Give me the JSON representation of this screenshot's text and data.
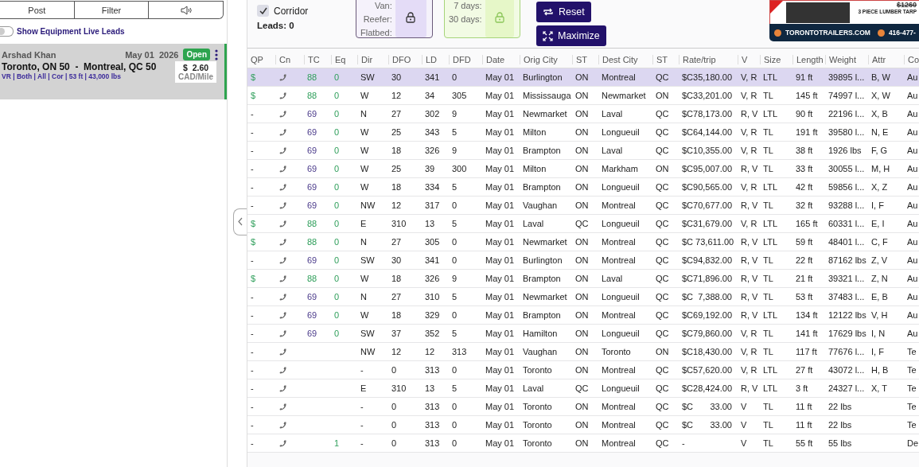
{
  "left_panel": {
    "tabs": [
      {
        "kind": "text",
        "label": "Post"
      },
      {
        "kind": "text",
        "label": "Filter"
      },
      {
        "kind": "sound"
      }
    ],
    "live_leads_toggle": {
      "label": "Show Equipment Live Leads",
      "on": false
    },
    "lead_card": {
      "name": "Arshad Khan",
      "date": "May 01  2026",
      "status": "Open",
      "route": "Toronto, ON 50  -  Montreal, QC 50",
      "details": "VR | Both | All | Cor | 53 ft | 43,000 lbs",
      "rate": "$  2.60",
      "rate_unit": "CAD/Mile"
    }
  },
  "toolbar": {
    "corridor": {
      "label": "Corridor",
      "checked": true
    },
    "leads": "Leads: 0",
    "equipment_box": {
      "labels": [
        "Van:",
        "Reefer:",
        "Flatbed:"
      ]
    },
    "period_box": {
      "labels": [
        "7 days:",
        "30 days:"
      ]
    },
    "buttons": [
      {
        "kind": "reset",
        "label": "Reset"
      },
      {
        "kind": "maximize",
        "label": "Maximize"
      }
    ]
  },
  "ad": {
    "old_price": "$1260",
    "product": "3 PIECE LUMBER TARP",
    "website": "TORONTOTRAILERS.COM",
    "phone": "416-477-"
  },
  "table": {
    "columns": [
      "QP",
      "Cn",
      "TC",
      "Eq",
      "Dir",
      "DFO",
      "LD",
      "DFD",
      "Date",
      "Orig City",
      "ST",
      "Dest City",
      "ST",
      "Rate/trip",
      "V",
      "Size",
      "Length",
      "Weight",
      "Attr",
      "Co"
    ],
    "rows": [
      {
        "selected": true,
        "kind": "quickpay",
        "qp": "$",
        "tc": "88",
        "eq": "0",
        "dir": "SW",
        "dfo": "30",
        "ld": "341",
        "dfd": "0",
        "date": "May 01",
        "orig": "Burlington",
        "ost": "ON",
        "dest": "Montreal",
        "dst": "QC",
        "rate": "$C35,180.00",
        "v": "V, R",
        "size": "LTL",
        "length": "91 ft",
        "weight": "39895 l...",
        "attr": "B, W",
        "col20": "Au"
      },
      {
        "selected": false,
        "kind": "quickpay",
        "qp": "$",
        "tc": "88",
        "eq": "0",
        "dir": "W",
        "dfo": "12",
        "ld": "34",
        "dfd": "305",
        "date": "May 01",
        "orig": "Mississauga",
        "ost": "ON",
        "dest": "Newmarket",
        "dst": "ON",
        "rate": "$C33,201.00",
        "v": "V, R",
        "size": "TL",
        "length": "145 ft",
        "weight": "74997 l...",
        "attr": "X, W",
        "col20": "Au"
      },
      {
        "selected": false,
        "kind": "standard",
        "qp": "-",
        "tc": "69",
        "eq": "0",
        "dir": "N",
        "dfo": "27",
        "ld": "302",
        "dfd": "9",
        "date": "May 01",
        "orig": "Newmarket",
        "ost": "ON",
        "dest": "Laval",
        "dst": "QC",
        "rate": "$C78,173.00",
        "v": "R, V",
        "size": "LTL",
        "length": "90 ft",
        "weight": "22196 l...",
        "attr": "X, B",
        "col20": "Au"
      },
      {
        "selected": false,
        "kind": "standard",
        "qp": "-",
        "tc": "69",
        "eq": "0",
        "dir": "W",
        "dfo": "25",
        "ld": "343",
        "dfd": "5",
        "date": "May 01",
        "orig": "Milton",
        "ost": "ON",
        "dest": "Longueuil",
        "dst": "QC",
        "rate": "$C64,144.00",
        "v": "V, R",
        "size": "TL",
        "length": "191 ft",
        "weight": "39580 l...",
        "attr": "N, E",
        "col20": "Au"
      },
      {
        "selected": false,
        "kind": "standard",
        "qp": "-",
        "tc": "69",
        "eq": "0",
        "dir": "W",
        "dfo": "18",
        "ld": "326",
        "dfd": "9",
        "date": "May 01",
        "orig": "Brampton",
        "ost": "ON",
        "dest": "Laval",
        "dst": "QC",
        "rate": "$C10,355.00",
        "v": "V, R",
        "size": "TL",
        "length": "38 ft",
        "weight": "1926 lbs",
        "attr": "F, G",
        "col20": "Au"
      },
      {
        "selected": false,
        "kind": "standard",
        "qp": "-",
        "tc": "69",
        "eq": "0",
        "dir": "W",
        "dfo": "25",
        "ld": "39",
        "dfd": "300",
        "date": "May 01",
        "orig": "Milton",
        "ost": "ON",
        "dest": "Markham",
        "dst": "ON",
        "rate": "$C95,007.00",
        "v": "R, V",
        "size": "TL",
        "length": "33 ft",
        "weight": "30055 l...",
        "attr": "M, H",
        "col20": "Au"
      },
      {
        "selected": false,
        "kind": "standard",
        "qp": "-",
        "tc": "69",
        "eq": "0",
        "dir": "W",
        "dfo": "18",
        "ld": "334",
        "dfd": "5",
        "date": "May 01",
        "orig": "Brampton",
        "ost": "ON",
        "dest": "Longueuil",
        "dst": "QC",
        "rate": "$C90,565.00",
        "v": "V, R",
        "size": "LTL",
        "length": "42 ft",
        "weight": "59856 l...",
        "attr": "X, Z",
        "col20": "Au"
      },
      {
        "selected": false,
        "kind": "standard",
        "qp": "-",
        "tc": "69",
        "eq": "0",
        "dir": "NW",
        "dfo": "12",
        "ld": "317",
        "dfd": "0",
        "date": "May 01",
        "orig": "Vaughan",
        "ost": "ON",
        "dest": "Montreal",
        "dst": "QC",
        "rate": "$C70,677.00",
        "v": "R, V",
        "size": "TL",
        "length": "32 ft",
        "weight": "93288 l...",
        "attr": "I, F",
        "col20": "Au"
      },
      {
        "selected": false,
        "kind": "quickpay",
        "qp": "$",
        "tc": "88",
        "eq": "0",
        "dir": "E",
        "dfo": "310",
        "ld": "13",
        "dfd": "5",
        "date": "May 01",
        "orig": "Laval",
        "ost": "QC",
        "dest": "Longueuil",
        "dst": "QC",
        "rate": "$C31,679.00",
        "v": "V, R",
        "size": "LTL",
        "length": "165 ft",
        "weight": "60331 l...",
        "attr": "E, I",
        "col20": "Au"
      },
      {
        "selected": false,
        "kind": "quickpay",
        "qp": "$",
        "tc": "88",
        "eq": "0",
        "dir": "N",
        "dfo": "27",
        "ld": "305",
        "dfd": "0",
        "date": "May 01",
        "orig": "Newmarket",
        "ost": "ON",
        "dest": "Montreal",
        "dst": "QC",
        "rate": "$C 73,611.00",
        "v": "R, V",
        "size": "LTL",
        "length": "59 ft",
        "weight": "48401 l...",
        "attr": "C, F",
        "col20": "Au"
      },
      {
        "selected": false,
        "kind": "standard",
        "qp": "-",
        "tc": "69",
        "eq": "0",
        "dir": "SW",
        "dfo": "30",
        "ld": "341",
        "dfd": "0",
        "date": "May 01",
        "orig": "Burlington",
        "ost": "ON",
        "dest": "Montreal",
        "dst": "QC",
        "rate": "$C94,832.00",
        "v": "R, V",
        "size": "TL",
        "length": "22 ft",
        "weight": "87162 lbs",
        "attr": "Z, V",
        "col20": "Au"
      },
      {
        "selected": false,
        "kind": "quickpay",
        "qp": "$",
        "tc": "88",
        "eq": "0",
        "dir": "W",
        "dfo": "18",
        "ld": "326",
        "dfd": "9",
        "date": "May 01",
        "orig": "Brampton",
        "ost": "ON",
        "dest": "Laval",
        "dst": "QC",
        "rate": "$C71,896.00",
        "v": "R, V",
        "size": "TL",
        "length": "21 ft",
        "weight": "39321 l...",
        "attr": "Z, N",
        "col20": "Au"
      },
      {
        "selected": false,
        "kind": "standard",
        "qp": "-",
        "tc": "69",
        "eq": "0",
        "dir": "N",
        "dfo": "27",
        "ld": "310",
        "dfd": "5",
        "date": "May 01",
        "orig": "Newmarket",
        "ost": "ON",
        "dest": "Longueuil",
        "dst": "QC",
        "rate": "$C  7,388.00",
        "v": "R, V",
        "size": "TL",
        "length": "53 ft",
        "weight": "37483 l...",
        "attr": "E, B",
        "col20": "Au"
      },
      {
        "selected": false,
        "kind": "standard",
        "qp": "-",
        "tc": "69",
        "eq": "0",
        "dir": "W",
        "dfo": "18",
        "ld": "329",
        "dfd": "0",
        "date": "May 01",
        "orig": "Brampton",
        "ost": "ON",
        "dest": "Montreal",
        "dst": "QC",
        "rate": "$C69,192.00",
        "v": "R, V",
        "size": "LTL",
        "length": "134 ft",
        "weight": "12122 lbs",
        "attr": "V, H",
        "col20": "Au"
      },
      {
        "selected": false,
        "kind": "standard",
        "qp": "-",
        "tc": "69",
        "eq": "0",
        "dir": "SW",
        "dfo": "37",
        "ld": "352",
        "dfd": "5",
        "date": "May 01",
        "orig": "Hamilton",
        "ost": "ON",
        "dest": "Longueuil",
        "dst": "QC",
        "rate": "$C79,860.00",
        "v": "V, R",
        "size": "TL",
        "length": "141 ft",
        "weight": "17629 lbs",
        "attr": "I, N",
        "col20": "Au"
      },
      {
        "selected": false,
        "kind": "plain",
        "qp": "-",
        "dir": "NW",
        "dfo": "12",
        "ld": "12",
        "dfd": "313",
        "date": "May 01",
        "orig": "Vaughan",
        "ost": "ON",
        "dest": "Toronto",
        "dst": "ON",
        "rate": "$C18,430.00",
        "v": "V, R",
        "size": "TL",
        "length": "117 ft",
        "weight": "77676 l...",
        "attr": "I, F",
        "col20": "Te"
      },
      {
        "selected": false,
        "kind": "plain",
        "qp": "-",
        "dir": "-",
        "dfo": "0",
        "ld": "313",
        "dfd": "0",
        "date": "May 01",
        "orig": "Toronto",
        "ost": "ON",
        "dest": "Montreal",
        "dst": "QC",
        "rate": "$C57,620.00",
        "v": "V, R",
        "size": "LTL",
        "length": "27 ft",
        "weight": "43072 l...",
        "attr": "H, B",
        "col20": "Te"
      },
      {
        "selected": false,
        "kind": "plain",
        "qp": "-",
        "dir": "E",
        "dfo": "310",
        "ld": "13",
        "dfd": "5",
        "date": "May 01",
        "orig": "Laval",
        "ost": "QC",
        "dest": "Longueuil",
        "dst": "QC",
        "rate": "$C28,424.00",
        "v": "R, V",
        "size": "LTL",
        "length": "3 ft",
        "weight": "24327 l...",
        "attr": "X, T",
        "col20": "Te"
      },
      {
        "selected": false,
        "kind": "plain",
        "qp": "-",
        "dir": "-",
        "dfo": "0",
        "ld": "313",
        "dfd": "0",
        "date": "May 01",
        "orig": "Toronto",
        "ost": "ON",
        "dest": "Montreal",
        "dst": "QC",
        "rate": "$C       33.00",
        "v": "V",
        "size": "TL",
        "length": "11 ft",
        "weight": "22 lbs",
        "col20": "Te"
      },
      {
        "selected": false,
        "kind": "plain",
        "qp": "-",
        "dir": "-",
        "dfo": "0",
        "ld": "313",
        "dfd": "0",
        "date": "May 01",
        "orig": "Toronto",
        "ost": "ON",
        "dest": "Montreal",
        "dst": "QC",
        "rate": "$C       33.00",
        "v": "V",
        "size": "TL",
        "length": "11 ft",
        "weight": "22 lbs",
        "col20": "Te"
      },
      {
        "selected": false,
        "kind": "plain",
        "qp": "-",
        "eq": "1",
        "dir": "-",
        "dfo": "0",
        "ld": "313",
        "dfd": "0",
        "date": "May 01",
        "orig": "Toronto",
        "ost": "ON",
        "dest": "Montreal",
        "dst": "QC",
        "rate": "-",
        "v": "V",
        "size": "TL",
        "length": "55 ft",
        "weight": "55 lbs",
        "col20": "De"
      }
    ]
  }
}
